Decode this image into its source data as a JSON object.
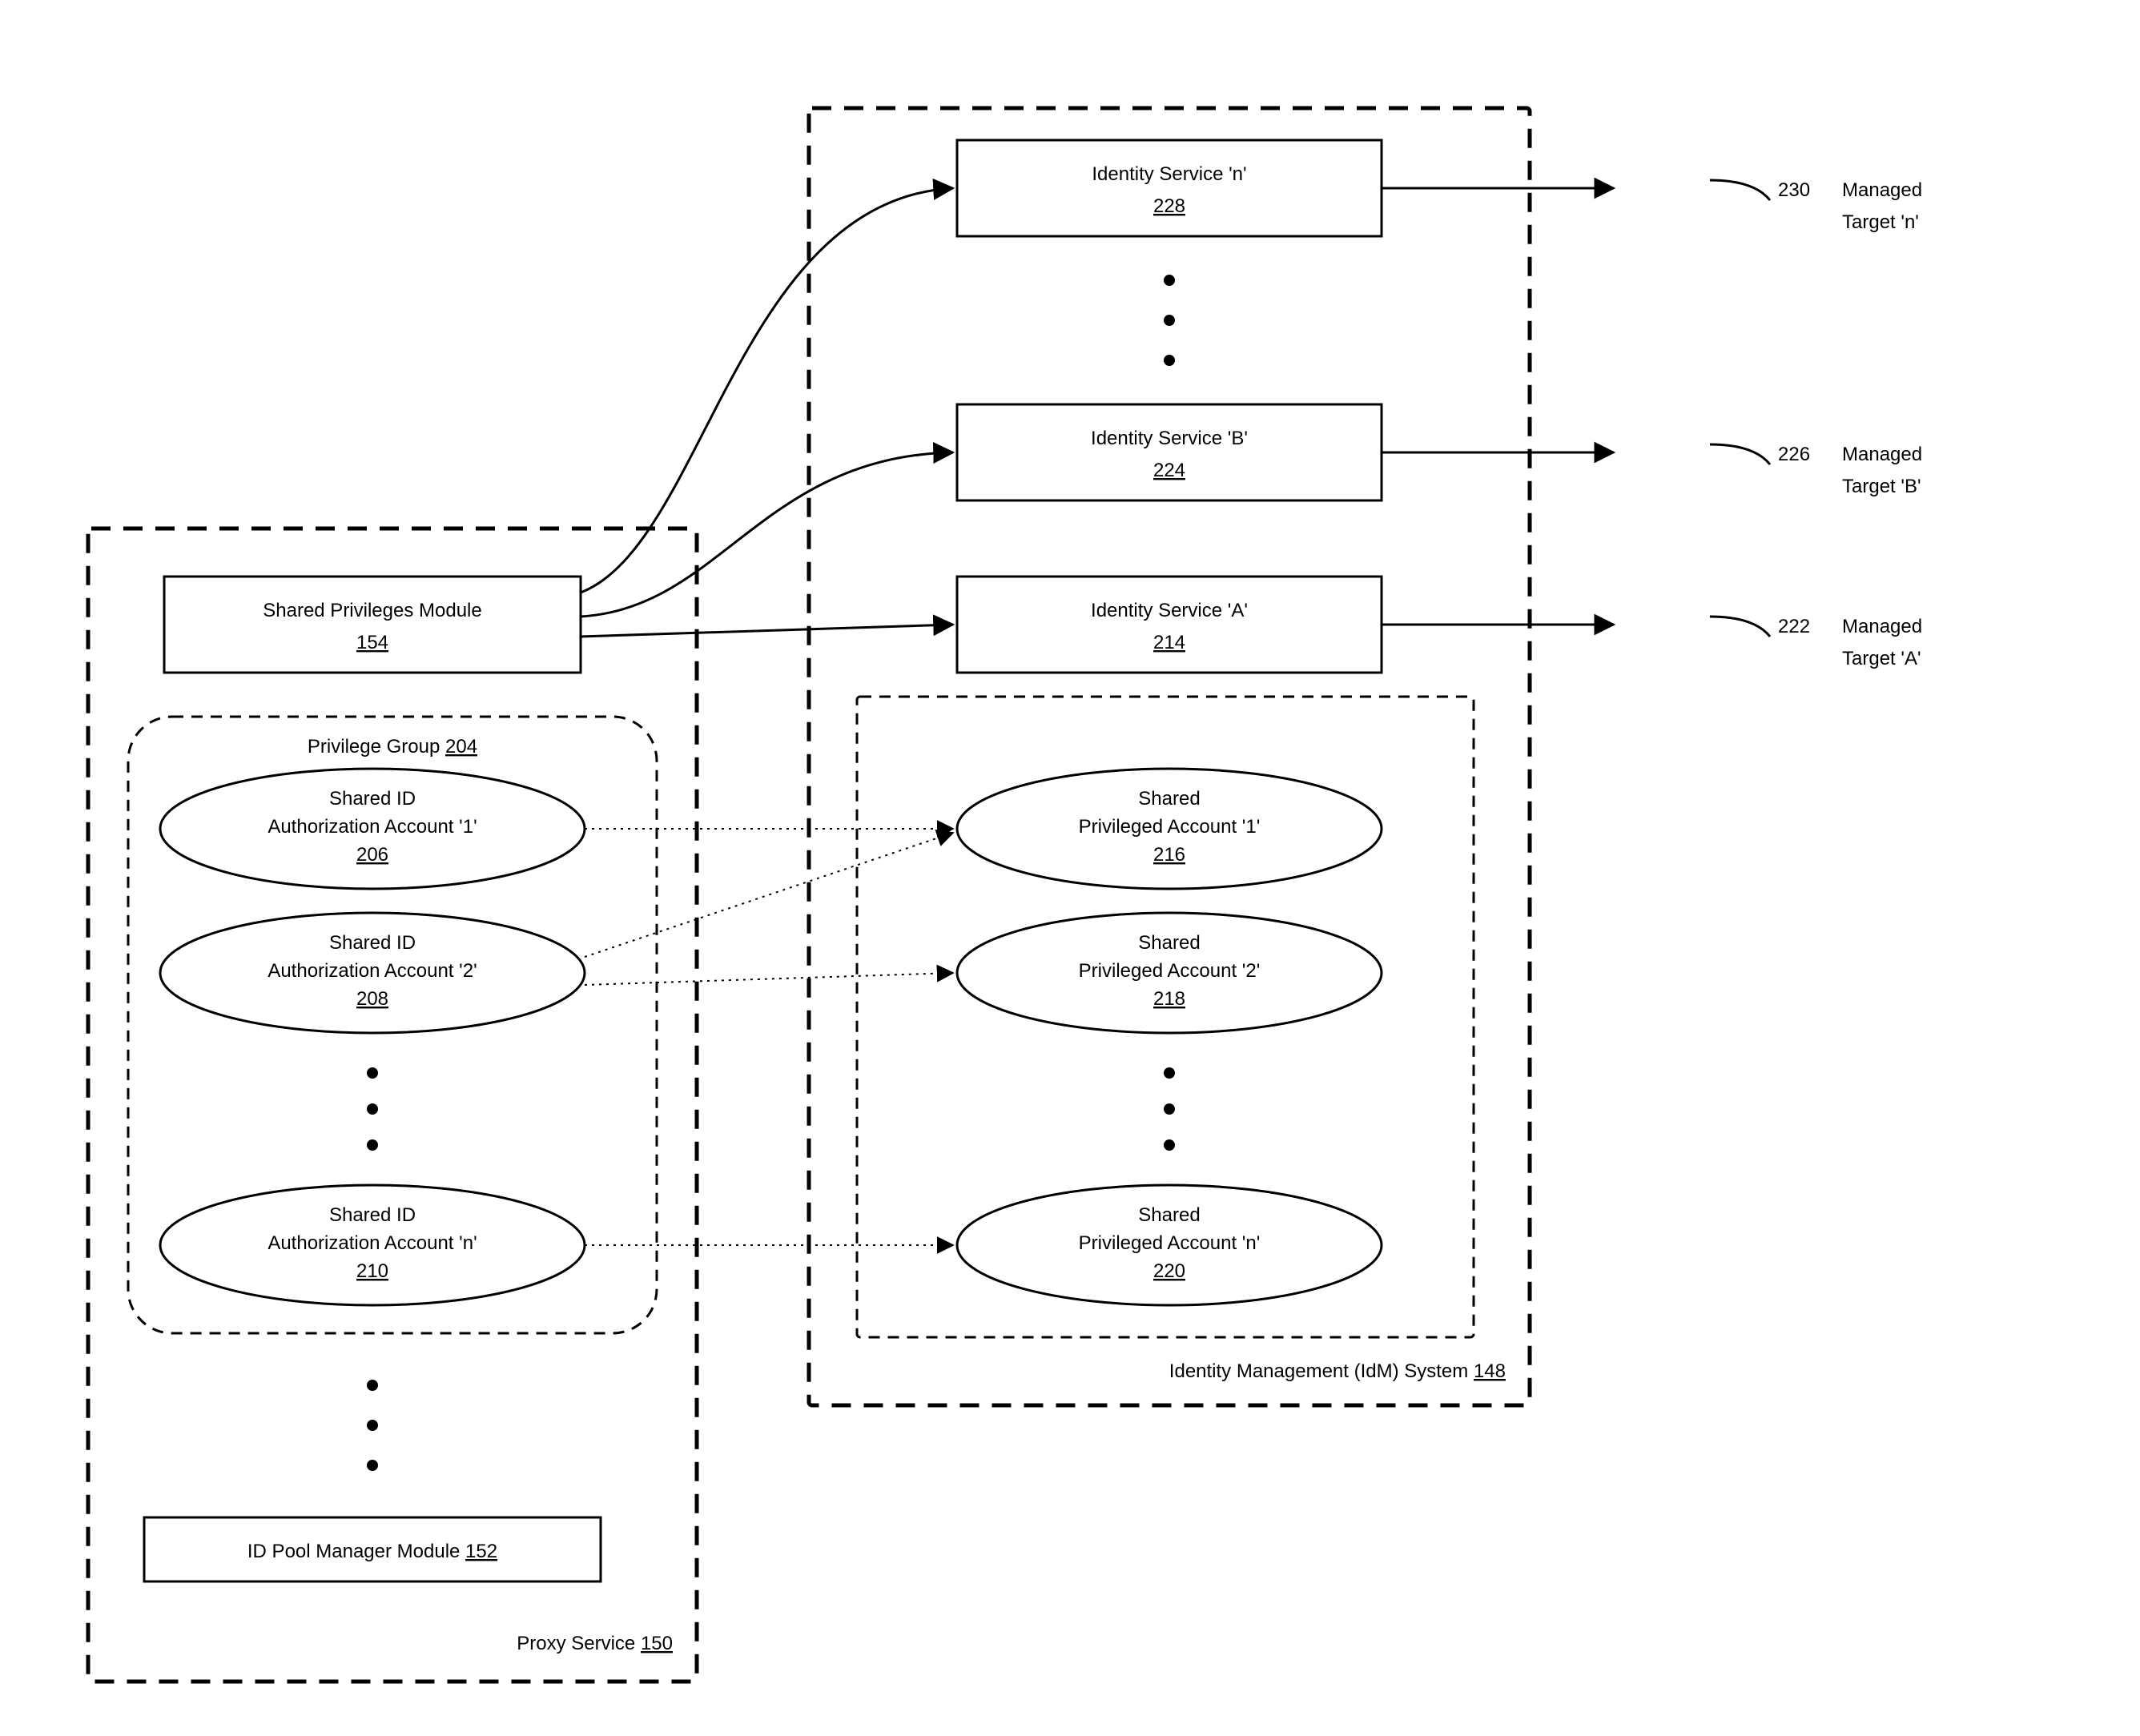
{
  "proxy_service": {
    "label": "Proxy Service",
    "ref": "150",
    "shared_priv_module": {
      "label": "Shared Privileges Module",
      "ref": "154"
    },
    "privilege_group": {
      "label": "Privilege Group",
      "ref": "204",
      "accounts": [
        {
          "line1": "Shared ID",
          "line2": "Authorization Account '1'",
          "ref": "206"
        },
        {
          "line1": "Shared ID",
          "line2": "Authorization Account '2'",
          "ref": "208"
        },
        {
          "line1": "Shared ID",
          "line2": "Authorization Account 'n'",
          "ref": "210"
        }
      ]
    },
    "id_pool_manager": {
      "label": "ID Pool Manager Module",
      "ref": "152"
    }
  },
  "idm_system": {
    "label": "Identity Management (IdM) System",
    "ref": "148",
    "services": [
      {
        "label": "Identity Service 'n'",
        "ref": "228"
      },
      {
        "label": "Identity Service 'B'",
        "ref": "224"
      },
      {
        "label": "Identity Service 'A'",
        "ref": "214"
      }
    ],
    "shared_priv_accounts": [
      {
        "line1": "Shared",
        "line2": "Privileged Account '1'",
        "ref": "216"
      },
      {
        "line1": "Shared",
        "line2": "Privileged Account '2'",
        "ref": "218"
      },
      {
        "line1": "Shared",
        "line2": "Privileged Account 'n'",
        "ref": "220"
      }
    ]
  },
  "targets": [
    {
      "ref": "230",
      "line1": "Managed",
      "line2": "Target 'n'"
    },
    {
      "ref": "226",
      "line1": "Managed",
      "line2": "Target 'B'"
    },
    {
      "ref": "222",
      "line1": "Managed",
      "line2": "Target 'A'"
    }
  ]
}
